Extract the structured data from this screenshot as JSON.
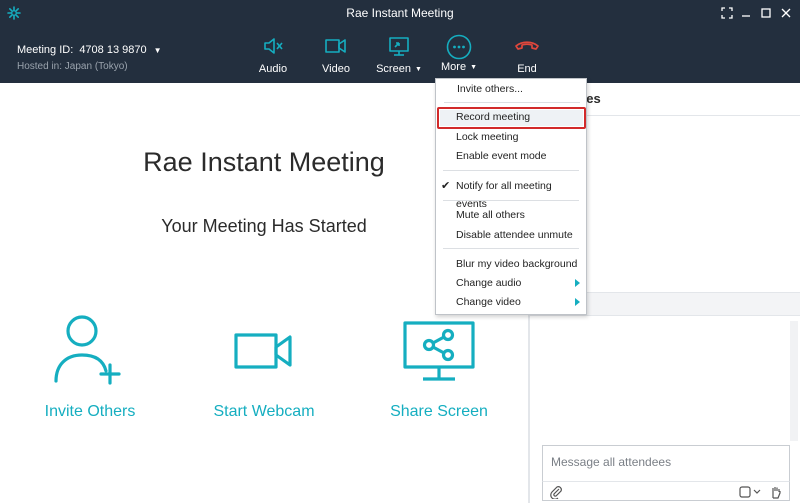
{
  "window": {
    "title": "Rae Instant Meeting",
    "controls": [
      "grid-view-icon",
      "minimize-icon",
      "maximize-icon",
      "close-icon"
    ]
  },
  "meeting": {
    "id_label": "Meeting ID:",
    "id_value": "4708 13 9870",
    "hosted_in": "Hosted in: Japan (Tokyo)"
  },
  "toolbar": {
    "audio": "Audio",
    "video": "Video",
    "screen": "Screen",
    "more": "More",
    "end": "End"
  },
  "main": {
    "title": "Rae Instant Meeting",
    "subtitle": "Your Meeting Has Started",
    "actions": {
      "invite": "Invite Others",
      "webcam": "Start Webcam",
      "share": "Share Screen"
    }
  },
  "sidebar": {
    "header_fragment": "ees",
    "chat_placeholder": "Message all attendees"
  },
  "menu": {
    "items": [
      "Invite others...",
      "Record meeting",
      "Lock meeting",
      "Enable event mode",
      "Notify for all meeting events",
      "Mute all others",
      "Disable attendee unmute",
      "Blur my video background",
      "Change audio",
      "Change video"
    ],
    "checked_item": "Notify for all meeting events",
    "highlighted_item": "Record meeting"
  },
  "colors": {
    "header_bg": "#232f3e",
    "accent": "#15aec0",
    "end_red": "#e0473c",
    "highlight_border": "#d22a2a"
  }
}
